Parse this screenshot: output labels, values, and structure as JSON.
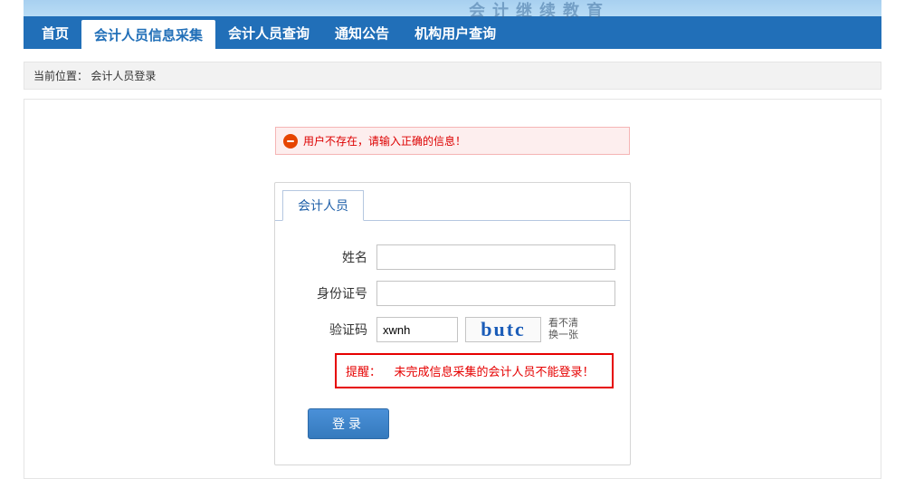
{
  "header": {
    "faint_title": "会计继续教育"
  },
  "nav": {
    "items": [
      "首页",
      "会计人员信息采集",
      "会计人员查询",
      "通知公告",
      "机构用户查询"
    ],
    "active_index": 1
  },
  "breadcrumb": {
    "prefix": "当前位置：",
    "path": "会计人员登录"
  },
  "error": {
    "message": "用户不存在，请输入正确的信息！"
  },
  "login": {
    "tab_label": "会计人员",
    "fields": {
      "name_label": "姓名",
      "name_value": "",
      "id_label": "身份证号",
      "id_value": "",
      "captcha_label": "验证码",
      "captcha_value": "xwnh",
      "captcha_image_text": "butc",
      "refresh_line1": "看不清",
      "refresh_line2": "换一张"
    },
    "warning": {
      "prefix": "提醒：",
      "text": "未完成信息采集的会计人员不能登录！"
    },
    "submit_label": "登录"
  }
}
